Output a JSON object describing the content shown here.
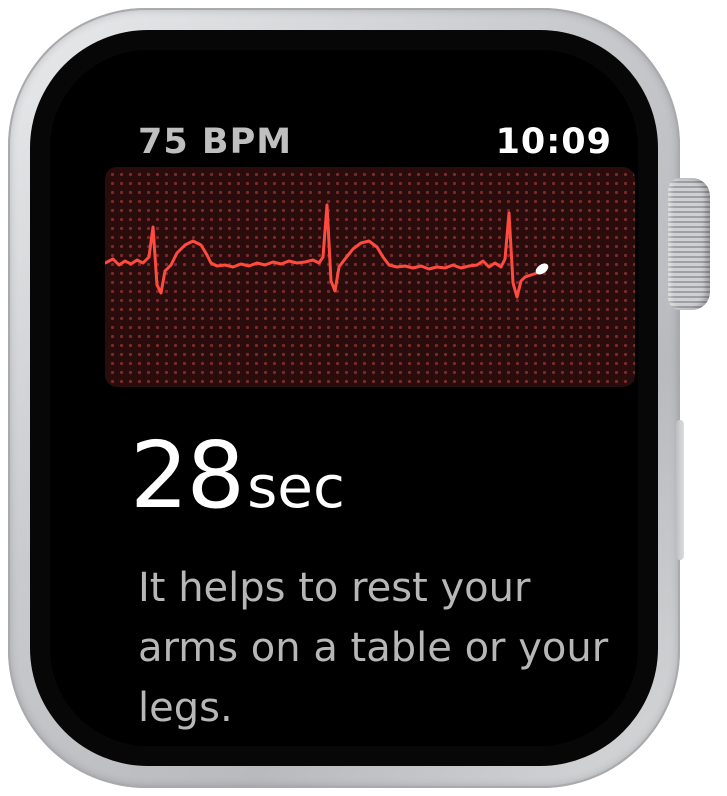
{
  "status_bar": {
    "heart_rate": "75 BPM",
    "time": "10:09"
  },
  "ecg": {
    "trace_color": "#ff4a3d",
    "grid_color": "#7a2a2a",
    "background_color": "#2a0c0c"
  },
  "countdown": {
    "value": "28",
    "unit": "sec"
  },
  "instruction": {
    "text": "It helps to rest your arms on a table or your legs."
  },
  "colors": {
    "screen": "#000000",
    "case": "#c9cacd"
  }
}
